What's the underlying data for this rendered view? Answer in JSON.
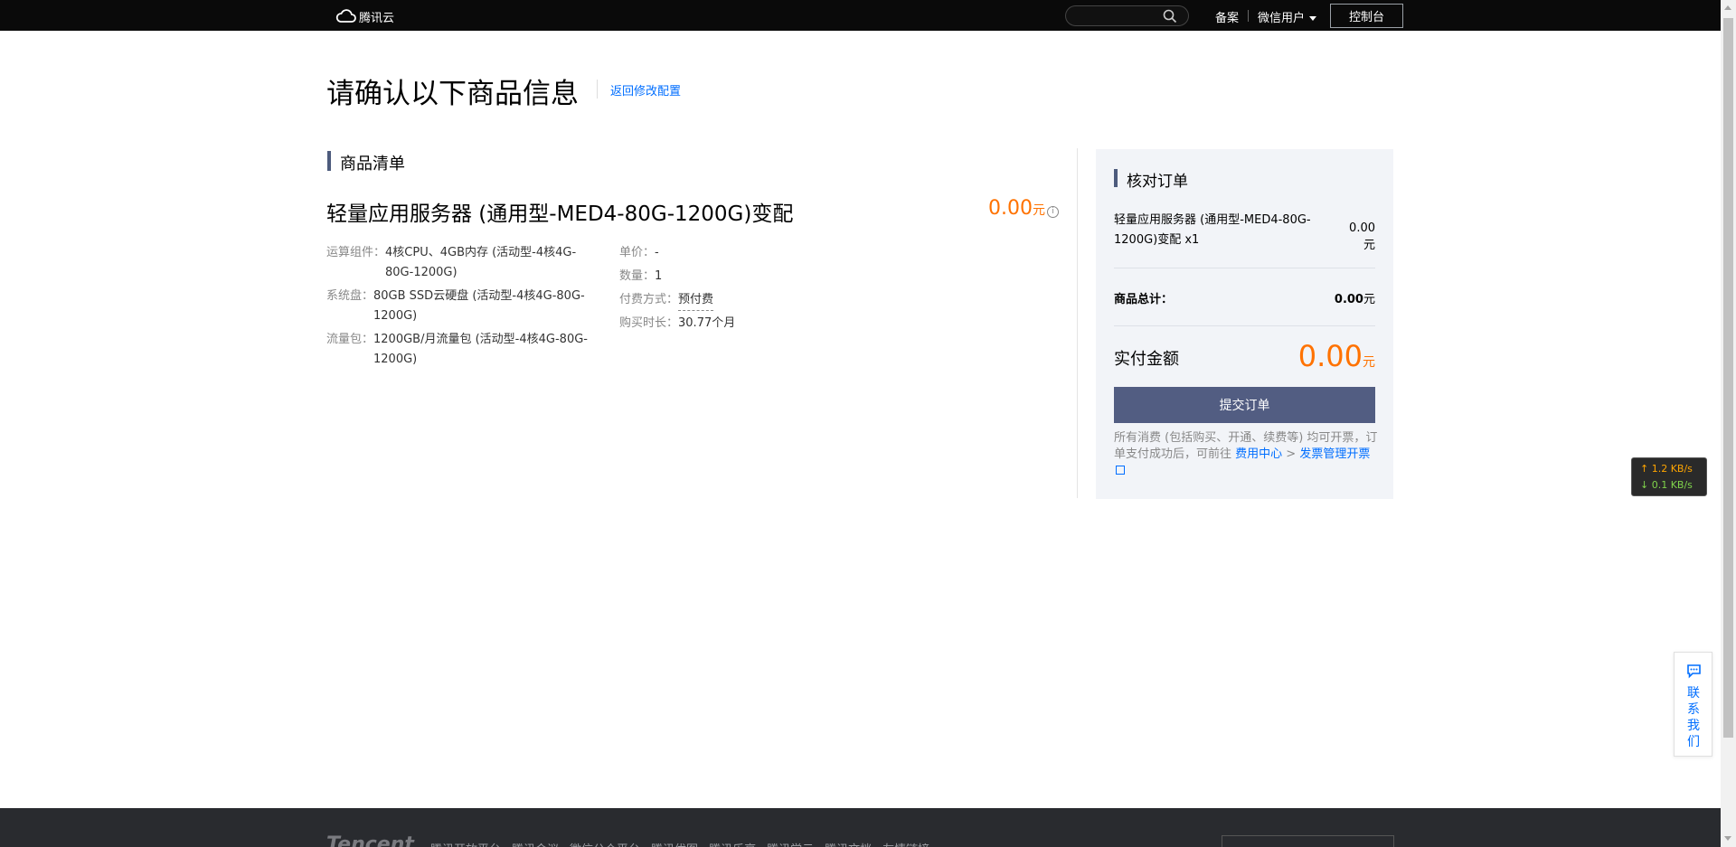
{
  "header": {
    "logo_text": "腾讯云",
    "links": {
      "beian": "备案",
      "user": "微信用户"
    },
    "console_label": "控制台"
  },
  "page": {
    "title": "请确认以下商品信息",
    "back_link": "返回修改配置"
  },
  "goods": {
    "section_title": "商品清单",
    "product_name": "轻量应用服务器 (通用型-MED4-80G-1200G)变配",
    "price": "0.00",
    "price_unit": "元",
    "specs_left": [
      {
        "key": "运算组件：",
        "value": "4核CPU、4GB内存 (活动型-4核4G-80G-1200G)"
      },
      {
        "key": "系统盘：",
        "value": "80GB SSD云硬盘 (活动型-4核4G-80G-1200G)"
      },
      {
        "key": "流量包：",
        "value": "1200GB/月流量包 (活动型-4核4G-80G-1200G)"
      }
    ],
    "specs_right": [
      {
        "key": "单价：",
        "value": "-"
      },
      {
        "key": "数量：",
        "value": "1"
      },
      {
        "key": "付费方式：",
        "value": "预付费"
      },
      {
        "key": "购买时长：",
        "value": "30.77个月"
      }
    ]
  },
  "summary": {
    "title": "核对订单",
    "item_name": "轻量应用服务器 (通用型-MED4-80G-1200G)变配 x1",
    "item_price": "0.00元",
    "total_label": "商品总计：",
    "total_value": "0.00",
    "total_unit": "元",
    "pay_label": "实付金额",
    "pay_value": "0.00",
    "pay_unit": "元",
    "submit_label": "提交订单",
    "notice_text": "所有消费 (包括购买、开通、续费等) 均可开票，订单支付成功后，可前往 ",
    "notice_link1": "费用中心",
    "notice_sep": " > ",
    "notice_link2": "发票管理开票"
  },
  "netspeed": {
    "up": "↑ 1.2 KB/s",
    "down": "↓ 0.1 KB/s"
  },
  "contact": {
    "label": "联系我们"
  },
  "footer": {
    "logo": "Tencent",
    "links": [
      "腾讯开放平台",
      "腾讯会议",
      "微信公众平台",
      "腾讯优图",
      "腾讯乐享",
      "腾讯学云",
      "腾讯文档",
      "友情链接"
    ]
  },
  "colors": {
    "accent": "#006eff",
    "price": "#ff7200",
    "button": "#525d82",
    "section_bar": "#4d5b7d"
  }
}
